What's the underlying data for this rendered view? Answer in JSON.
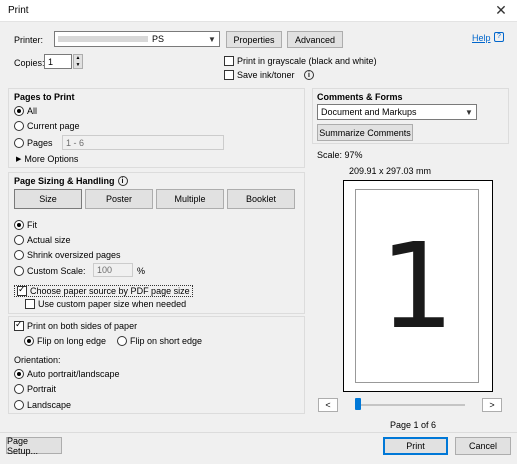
{
  "window": {
    "title": "Print"
  },
  "printer": {
    "label": "Printer:",
    "value_suffix": "PS",
    "properties_label": "Properties",
    "advanced_label": "Advanced",
    "help_label": "Help"
  },
  "copies": {
    "label": "Copies:",
    "value": "1"
  },
  "options": {
    "grayscale_label": "Print in grayscale (black and white)",
    "save_ink_label": "Save ink/toner"
  },
  "pages_to_print": {
    "header": "Pages to Print",
    "all_label": "All",
    "current_label": "Current page",
    "pages_label": "Pages",
    "pages_value": "1 - 6",
    "more_options_label": "More Options"
  },
  "sizing": {
    "header": "Page Sizing & Handling",
    "tabs": [
      "Size",
      "Poster",
      "Multiple",
      "Booklet"
    ],
    "fit_label": "Fit",
    "actual_label": "Actual size",
    "shrink_label": "Shrink oversized pages",
    "custom_label": "Custom Scale:",
    "custom_value": "100",
    "percent": "%",
    "paper_source_label": "Choose paper source by PDF page size",
    "custom_paper_label": "Use custom paper size when needed"
  },
  "duplex": {
    "both_sides_label": "Print on both sides of paper",
    "long_edge_label": "Flip on long edge",
    "short_edge_label": "Flip on short edge"
  },
  "orientation": {
    "label": "Orientation:",
    "auto_label": "Auto portrait/landscape",
    "portrait_label": "Portrait",
    "landscape_label": "Landscape"
  },
  "comments": {
    "header": "Comments & Forms",
    "selected": "Document and Markups",
    "summarize_label": "Summarize Comments"
  },
  "preview": {
    "scale_text": "Scale:  97%",
    "dimensions": "209.91 x 297.03 mm",
    "page_number_glyph": "1",
    "page_status": "Page 1 of 6",
    "prev_label": "<",
    "next_label": ">",
    "slider_fraction": 0.0
  },
  "footer": {
    "page_setup_label": "Page Setup...",
    "print_label": "Print",
    "cancel_label": "Cancel"
  },
  "colors": {
    "accent": "#0078d7",
    "link": "#0066cc"
  }
}
